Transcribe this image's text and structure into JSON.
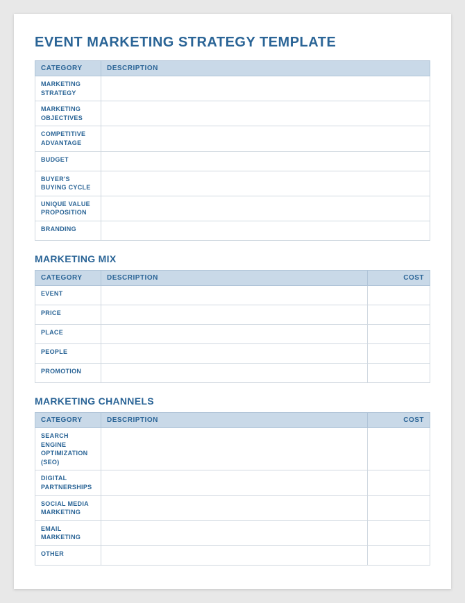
{
  "title": "EVENT MARKETING STRATEGY TEMPLATE",
  "section1": {
    "title": null,
    "headers": [
      "CATEGORY",
      "DESCRIPTION"
    ],
    "rows": [
      {
        "category": "MARKETING STRATEGY",
        "description": ""
      },
      {
        "category": "MARKETING OBJECTIVES",
        "description": ""
      },
      {
        "category": "COMPETITIVE ADVANTAGE",
        "description": ""
      },
      {
        "category": "BUDGET",
        "description": ""
      },
      {
        "category": "BUYER'S BUYING CYCLE",
        "description": ""
      },
      {
        "category": "UNIQUE VALUE PROPOSITION",
        "description": ""
      },
      {
        "category": "BRANDING",
        "description": ""
      }
    ]
  },
  "section2": {
    "title": "MARKETING MIX",
    "headers": [
      "CATEGORY",
      "DESCRIPTION",
      "COST"
    ],
    "rows": [
      {
        "category": "EVENT",
        "description": "",
        "cost": ""
      },
      {
        "category": "PRICE",
        "description": "",
        "cost": ""
      },
      {
        "category": "PLACE",
        "description": "",
        "cost": ""
      },
      {
        "category": "PEOPLE",
        "description": "",
        "cost": ""
      },
      {
        "category": "PROMOTION",
        "description": "",
        "cost": ""
      }
    ]
  },
  "section3": {
    "title": "MARKETING CHANNELS",
    "headers": [
      "CATEGORY",
      "DESCRIPTION",
      "COST"
    ],
    "rows": [
      {
        "category": "SEARCH ENGINE OPTIMIZATION (SEO)",
        "description": "",
        "cost": ""
      },
      {
        "category": "DIGITAL PARTNERSHIPS",
        "description": "",
        "cost": ""
      },
      {
        "category": "SOCIAL MEDIA MARKETING",
        "description": "",
        "cost": ""
      },
      {
        "category": "EMAIL MARKETING",
        "description": "",
        "cost": ""
      },
      {
        "category": "OTHER",
        "description": "",
        "cost": ""
      }
    ]
  }
}
